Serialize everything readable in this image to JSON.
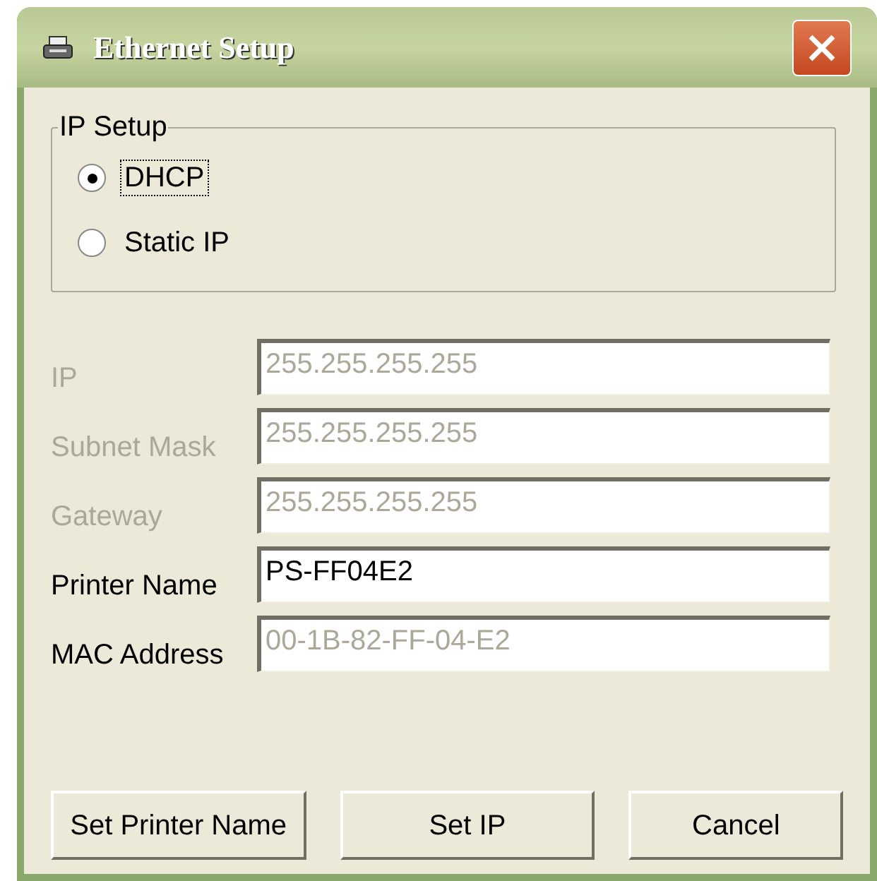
{
  "window": {
    "title": "Ethernet Setup"
  },
  "ip_setup": {
    "title": "IP Setup",
    "options": [
      {
        "label": "DHCP",
        "selected": true
      },
      {
        "label": "Static IP",
        "selected": false
      }
    ]
  },
  "fields": [
    {
      "label": "IP",
      "value": "255.255.255.255",
      "disabled": true,
      "read_only": false
    },
    {
      "label": "Subnet Mask",
      "value": "255.255.255.255",
      "disabled": true,
      "read_only": false
    },
    {
      "label": "Gateway",
      "value": "255.255.255.255",
      "disabled": true,
      "read_only": false
    },
    {
      "label": "Printer Name",
      "value": "PS-FF04E2",
      "disabled": false,
      "read_only": false
    },
    {
      "label": "MAC Address",
      "value": "00-1B-82-FF-04-E2",
      "disabled": false,
      "read_only": true
    }
  ],
  "buttons": [
    "Set Printer Name",
    "Set IP",
    "Cancel"
  ]
}
